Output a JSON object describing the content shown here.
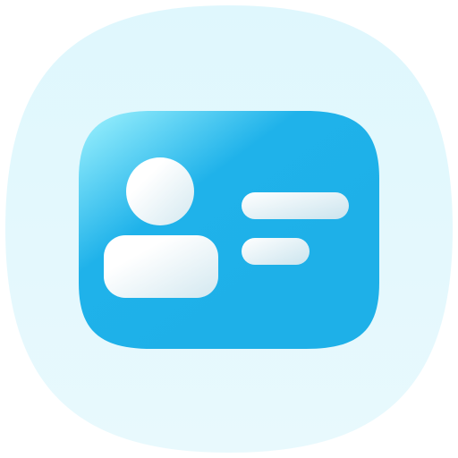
{
  "icon": {
    "name": "contact-card-icon",
    "colors": {
      "background_squircle_top": "#DFF7FD",
      "background_squircle_bottom": "#E8F9FD",
      "card_light": "#8EEAFB",
      "card_main": "#1FB2EA",
      "card_deep": "#1EB0E8",
      "foreground_light": "#FFFFFF",
      "foreground_shadow": "#D3E8F0"
    }
  }
}
